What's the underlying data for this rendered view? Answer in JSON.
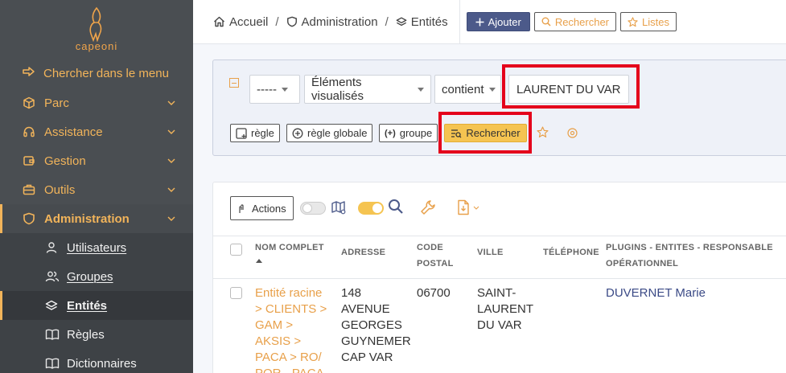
{
  "sidebar": {
    "logo_text": "capeoni",
    "search_label": "Chercher dans le menu",
    "items": [
      {
        "label": "Parc"
      },
      {
        "label": "Assistance"
      },
      {
        "label": "Gestion"
      },
      {
        "label": "Outils"
      },
      {
        "label": "Administration"
      }
    ],
    "subitems": [
      {
        "label": "Utilisateurs"
      },
      {
        "label": "Groupes"
      },
      {
        "label": "Entités"
      },
      {
        "label": "Règles"
      },
      {
        "label": "Dictionnaires"
      }
    ]
  },
  "breadcrumb": {
    "home": "Accueil",
    "admin": "Administration",
    "current": "Entités",
    "separator": "/"
  },
  "toolbar": {
    "add_label": "Ajouter",
    "search_label": "Rechercher",
    "lists_label": "Listes"
  },
  "search": {
    "field_select": "-----",
    "criteria_select": "Éléments visualisés",
    "operator_select": "contient",
    "value": "LAURENT DU VAR",
    "rule_label": "règle",
    "global_rule_label": "règle globale",
    "group_label": "groupe",
    "search_button": "Rechercher"
  },
  "results": {
    "actions_label": "Actions",
    "columns": {
      "name": [
        "NOM COMPLET"
      ],
      "address": "ADRESSE",
      "postal": [
        "CODE",
        "POSTAL"
      ],
      "city": "VILLE",
      "phone": "TÉLÉPHONE",
      "plugin": [
        "PLUGINS - ENTITES - RESPONSABLE",
        "OPÉRATIONNEL"
      ]
    },
    "row": {
      "name_lines": [
        "Entité racine",
        "> CLIENTS >",
        "GAM >",
        "AKSIS >",
        "PACA > RO/",
        "POR - PACA"
      ],
      "address_lines": [
        "148",
        "AVENUE",
        "GEORGES",
        "GUYNEMER",
        "CAP VAR"
      ],
      "postal": "06700",
      "city_lines": [
        "SAINT-",
        "LAURENT",
        "DU VAR"
      ],
      "phone": "",
      "responsable": "DUVERNET Marie"
    }
  },
  "colors": {
    "accent": "#f2b45a",
    "sidebar_bg": "#4a4e52",
    "primary": "#4c5a8a",
    "highlight": "#e4001b",
    "search_button": "#f5c451"
  }
}
